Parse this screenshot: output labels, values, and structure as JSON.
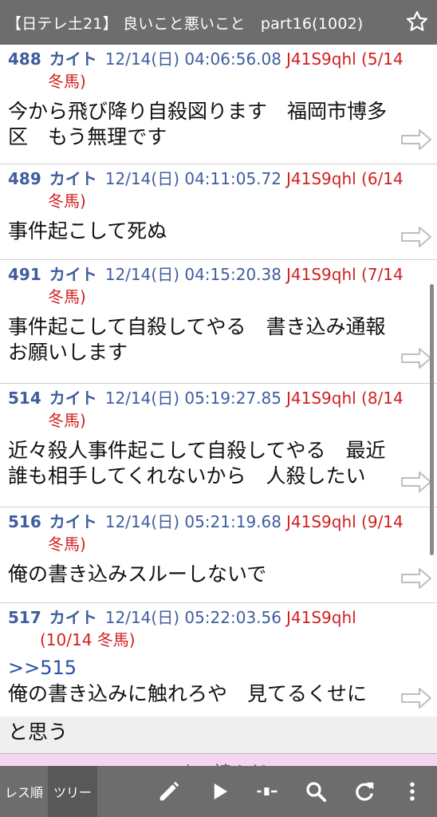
{
  "header": {
    "title": "【日テレ土21】 良いこと悪いこと　part16(1002)",
    "star_icon": "star-outline-icon"
  },
  "posts": [
    {
      "num": "488",
      "name": "カイト",
      "date": "12/14(日) 04:06:56.08",
      "id_line1": "J41S9qhl (5/14",
      "id_line2": "冬馬)",
      "body_lines": [
        "今から飛び降り自殺図ります　福岡市博多",
        "区　もう無理です"
      ]
    },
    {
      "num": "489",
      "name": "カイト",
      "date": "12/14(日) 04:11:05.72",
      "id_line1": "J41S9qhl (6/14",
      "id_line2": "冬馬)",
      "body_lines": [
        "事件起こして死ぬ"
      ]
    },
    {
      "num": "491",
      "name": "カイト",
      "date": "12/14(日) 04:15:20.38",
      "id_line1": "J41S9qhl (7/14",
      "id_line2": "冬馬)",
      "body_lines": [
        "事件起こして自殺してやる　書き込み通報",
        "お願いします"
      ]
    },
    {
      "num": "514",
      "name": "カイト",
      "date": "12/14(日) 05:19:27.85",
      "id_line1": "J41S9qhl (8/14",
      "id_line2": "冬馬)",
      "body_lines": [
        "近々殺人事件起こして自殺してやる　最近",
        "誰も相手してくれないから　人殺したい"
      ]
    },
    {
      "num": "516",
      "name": "カイト",
      "date": "12/14(日) 05:21:19.68",
      "id_line1": "J41S9qhl (9/14",
      "id_line2": "冬馬)",
      "body_lines": [
        "俺の書き込みスルーしないで"
      ]
    },
    {
      "num": "517",
      "name": "カイト",
      "date": "12/14(日) 05:22:03.56",
      "id_line1": "J41S9qhl",
      "id_line2": "(10/14 冬馬)",
      "anchor": ">>515",
      "body_lines": [
        "俺の書き込みに触れろや　見てるくせに"
      ]
    }
  ],
  "last_line": "と思う",
  "pink_strip_text": "ここまで読んだ",
  "toolbar": {
    "tab_reso": "レス順",
    "tab_tree": "ツリー",
    "icons": [
      "pencil-icon",
      "play-icon",
      "slider-icon",
      "search-icon",
      "refresh-icon",
      "more-vert-icon"
    ]
  },
  "colors": {
    "header_bg": "#6d6d6d",
    "meta_blue": "#3f5d9e",
    "id_red": "#d02020",
    "anchor_blue": "#2a4ea8",
    "pink": "#f5d6f0"
  }
}
